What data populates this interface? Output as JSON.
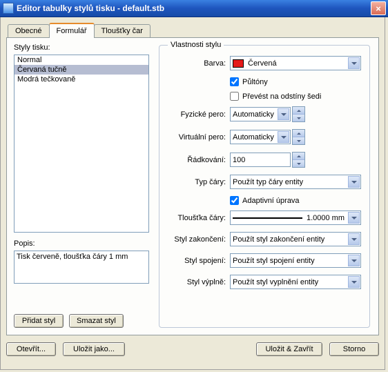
{
  "window": {
    "title": "Editor tabulky stylů tisku - default.stb",
    "close": "×"
  },
  "tabs": {
    "t1": "Obecné",
    "t2": "Formulář",
    "t3": "Tloušťky čar"
  },
  "left": {
    "styles_label": "Styly tisku:",
    "items": {
      "i1": "Normal",
      "i2": "Červaná tučně",
      "i3": "Modrá tečkovaně"
    },
    "desc_label": "Popis:",
    "desc_value": "Tisk červeně, tloušťka čáry 1 mm",
    "btn_add": "Přidat styl",
    "btn_del": "Smazat styl"
  },
  "group": {
    "legend": "Vlastnosti stylu",
    "color_label": "Barva:",
    "color_value": "Červená",
    "chk_halftone": "Půltóny",
    "chk_gray": "Převést na odstíny šedi",
    "phys_pen_label": "Fyzické pero:",
    "phys_pen_value": "Automaticky",
    "virt_pen_label": "Virtuální pero:",
    "virt_pen_value": "Automaticky",
    "linespc_label": "Řádkování:",
    "linespc_value": "100",
    "linetype_label": "Typ čáry:",
    "linetype_value": "Použít typ čáry entity",
    "chk_adaptive": "Adaptivní úprava",
    "linewidth_label": "Tloušťka čáry:",
    "linewidth_value": "1.0000 mm",
    "endcap_label": "Styl zakončení:",
    "endcap_value": "Použít styl zakončení entity",
    "join_label": "Styl spojení:",
    "join_value": "Použít styl spojení entity",
    "fill_label": "Styl výplně:",
    "fill_value": "Použít styl vyplnění entity"
  },
  "bottom": {
    "open": "Otevřít...",
    "saveas": "Uložit jako...",
    "saveclose": "Uložit & Zavřít",
    "cancel": "Storno"
  }
}
